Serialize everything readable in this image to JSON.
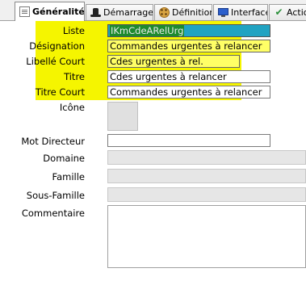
{
  "tabs": [
    {
      "label": "Généralités",
      "icon": "document-icon",
      "active": true
    },
    {
      "label": "Démarrage",
      "icon": "hat-icon",
      "active": false
    },
    {
      "label": "Définition",
      "icon": "cookie-icon",
      "active": false
    },
    {
      "label": "Interface",
      "icon": "monitor-icon",
      "active": false
    },
    {
      "label": "Actio",
      "icon": "check-icon",
      "active": false
    }
  ],
  "form": {
    "liste": {
      "label": "Liste",
      "value": "IKmCdeARelUrg"
    },
    "designation": {
      "label": "Désignation",
      "value": "Commandes urgentes à relancer"
    },
    "libelle_court": {
      "label": "Libellé Court",
      "value": "Cdes urgentes à rel."
    },
    "titre": {
      "label": "Titre",
      "value": "Cdes urgentes à relancer"
    },
    "titre_court": {
      "label": "Titre Court",
      "value": "Commandes urgentes à relancer"
    },
    "icone": {
      "label": "Icône"
    },
    "mot_directeur": {
      "label": "Mot Directeur",
      "value": ""
    },
    "domaine": {
      "label": "Domaine",
      "value": ""
    },
    "famille": {
      "label": "Famille",
      "value": ""
    },
    "sous_famille": {
      "label": "Sous-Famille",
      "value": ""
    },
    "commentaire": {
      "label": "Commentaire",
      "value": ""
    }
  },
  "colors": {
    "highlight": "#f5f500",
    "yellow_field": "#ffff66",
    "selection": "#1e8a2e",
    "cyan": "#21a3c2"
  }
}
